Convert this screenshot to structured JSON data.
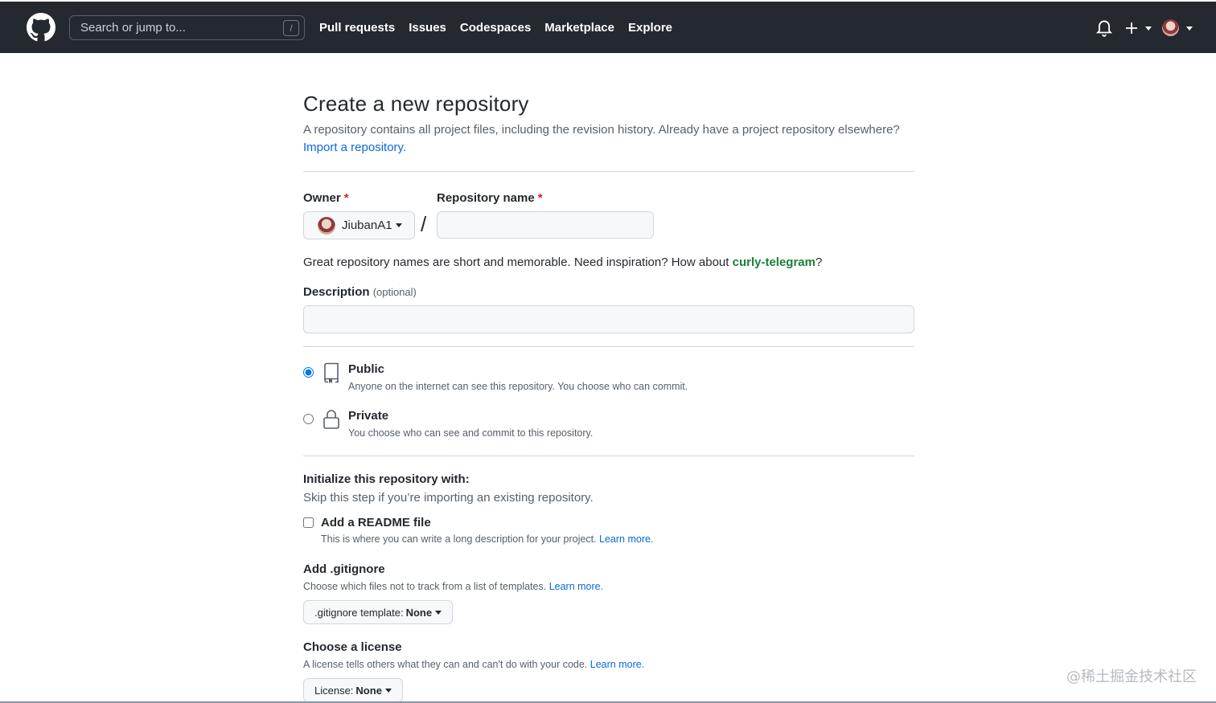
{
  "header": {
    "search_placeholder": "Search or jump to...",
    "search_shortcut": "/",
    "nav": [
      "Pull requests",
      "Issues",
      "Codespaces",
      "Marketplace",
      "Explore"
    ],
    "plus_label": "+"
  },
  "page": {
    "title": "Create a new repository",
    "subtitle": "A repository contains all project files, including the revision history. Already have a project repository elsewhere?",
    "import_link": "Import a repository.",
    "owner_label": "Owner",
    "required_mark": "*",
    "repo_name_label": "Repository name",
    "owner_value": "JiubanA1",
    "separator": "/",
    "repo_name_value": "",
    "hint_prefix": "Great repository names are short and memorable. Need inspiration? How about ",
    "hint_suggestion": "curly-telegram",
    "hint_suffix": "?",
    "description_label": "Description",
    "description_optional": "(optional)",
    "description_value": ""
  },
  "visibility": {
    "selected": "public",
    "public_title": "Public",
    "public_desc": "Anyone on the internet can see this repository. You choose who can commit.",
    "private_title": "Private",
    "private_desc": "You choose who can see and commit to this repository."
  },
  "init": {
    "title": "Initialize this repository with:",
    "subtitle": "Skip this step if you’re importing an existing repository.",
    "readme_title": "Add a README file",
    "readme_checked": false,
    "readme_desc": "This is where you can write a long description for your project.",
    "learn_more": "Learn more."
  },
  "gitignore": {
    "title": "Add .gitignore",
    "desc": "Choose which files not to track from a list of templates.",
    "learn_more": "Learn more.",
    "button_label": ".gitignore template:",
    "button_value": "None"
  },
  "license": {
    "title": "Choose a license",
    "desc": "A license tells others what they can and can't do with your code.",
    "learn_more": "Learn more.",
    "button_label": "License:",
    "button_value": "None"
  },
  "watermark": "@稀土掘金技术社区",
  "colors": {
    "header_bg": "#24292f",
    "link": "#0969da",
    "suggestion": "#1a7f37",
    "required": "#cf222e"
  }
}
